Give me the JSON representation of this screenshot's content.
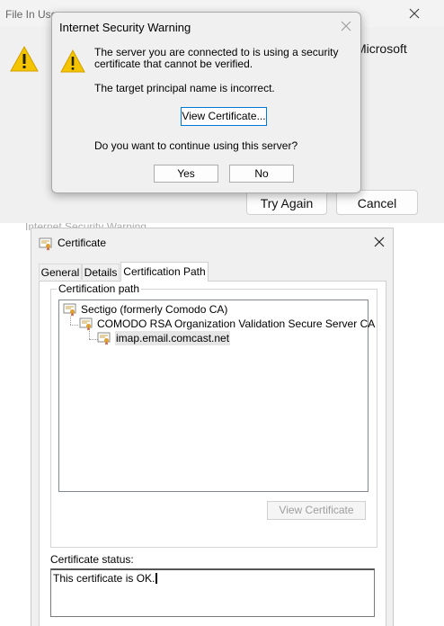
{
  "background_window": {
    "title": "File In Use",
    "microsoft_fragment": "Microsoft",
    "try_again_label": "Try Again",
    "cancel_label": "Cancel"
  },
  "security_warning": {
    "title": "Internet Security Warning",
    "message": "The server you are connected to is using a security certificate that cannot be verified.",
    "detail": "The target principal name is incorrect.",
    "view_certificate_label": "View Certificate...",
    "question": "Do you want to continue using this server?",
    "yes_label": "Yes",
    "no_label": "No"
  },
  "ghost_text": "Internet Security Warning",
  "certificate": {
    "title": "Certificate",
    "tabs": [
      {
        "label": "General",
        "selected": false
      },
      {
        "label": "Details",
        "selected": false
      },
      {
        "label": "Certification Path",
        "selected": true
      }
    ],
    "path_group_label": "Certification path",
    "path": [
      {
        "label": "Sectigo (formerly Comodo CA)",
        "level": 0
      },
      {
        "label": "COMODO RSA Organization Validation Secure Server CA",
        "level": 1
      },
      {
        "label": "imap.email.comcast.net",
        "level": 2,
        "selected": true
      }
    ],
    "view_certificate_label": "View Certificate",
    "status_label": "Certificate status:",
    "status_text": "This certificate is OK."
  },
  "icons": [
    "warning-icon",
    "close-icon",
    "certificate-icon"
  ],
  "colors": {
    "dialog_bg": "#f0f0f0",
    "default_button_border": "#0078d7",
    "warning_yellow": "#f5c400",
    "disabled_text": "#9e9e9e"
  }
}
